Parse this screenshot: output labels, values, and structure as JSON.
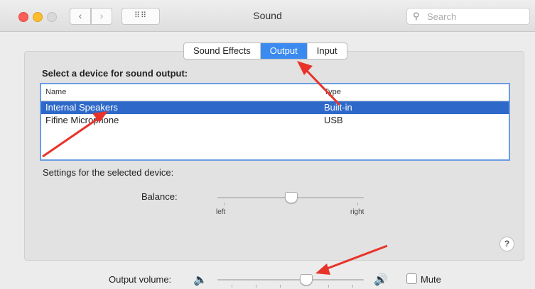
{
  "window": {
    "title": "Sound"
  },
  "toolbar": {
    "back_label": "‹",
    "forward_label": "›",
    "grid_label": "⠿⠿",
    "search_placeholder": "Search"
  },
  "tabs": [
    {
      "label": "Sound Effects",
      "active": false
    },
    {
      "label": "Output",
      "active": true
    },
    {
      "label": "Input",
      "active": false
    }
  ],
  "output": {
    "section_label": "Select a device for sound output:",
    "columns": [
      "Name",
      "Type"
    ],
    "devices": [
      {
        "name": "Internal Speakers",
        "type": "Built-in",
        "selected": true
      },
      {
        "name": "Fifine Microphone",
        "type": "USB",
        "selected": false
      }
    ]
  },
  "settings": {
    "label": "Settings for the selected device:",
    "balance_label": "Balance:",
    "balance_left": "left",
    "balance_right": "right",
    "balance_value": 0.5
  },
  "help_label": "?",
  "volume": {
    "label": "Output volume:",
    "level": 0.6,
    "mute_label": "Mute",
    "muted": false
  },
  "colors": {
    "accent": "#3b8af0",
    "selection": "#2e69c9",
    "annotation_arrow": "#e8332a"
  },
  "stray_mark": "."
}
